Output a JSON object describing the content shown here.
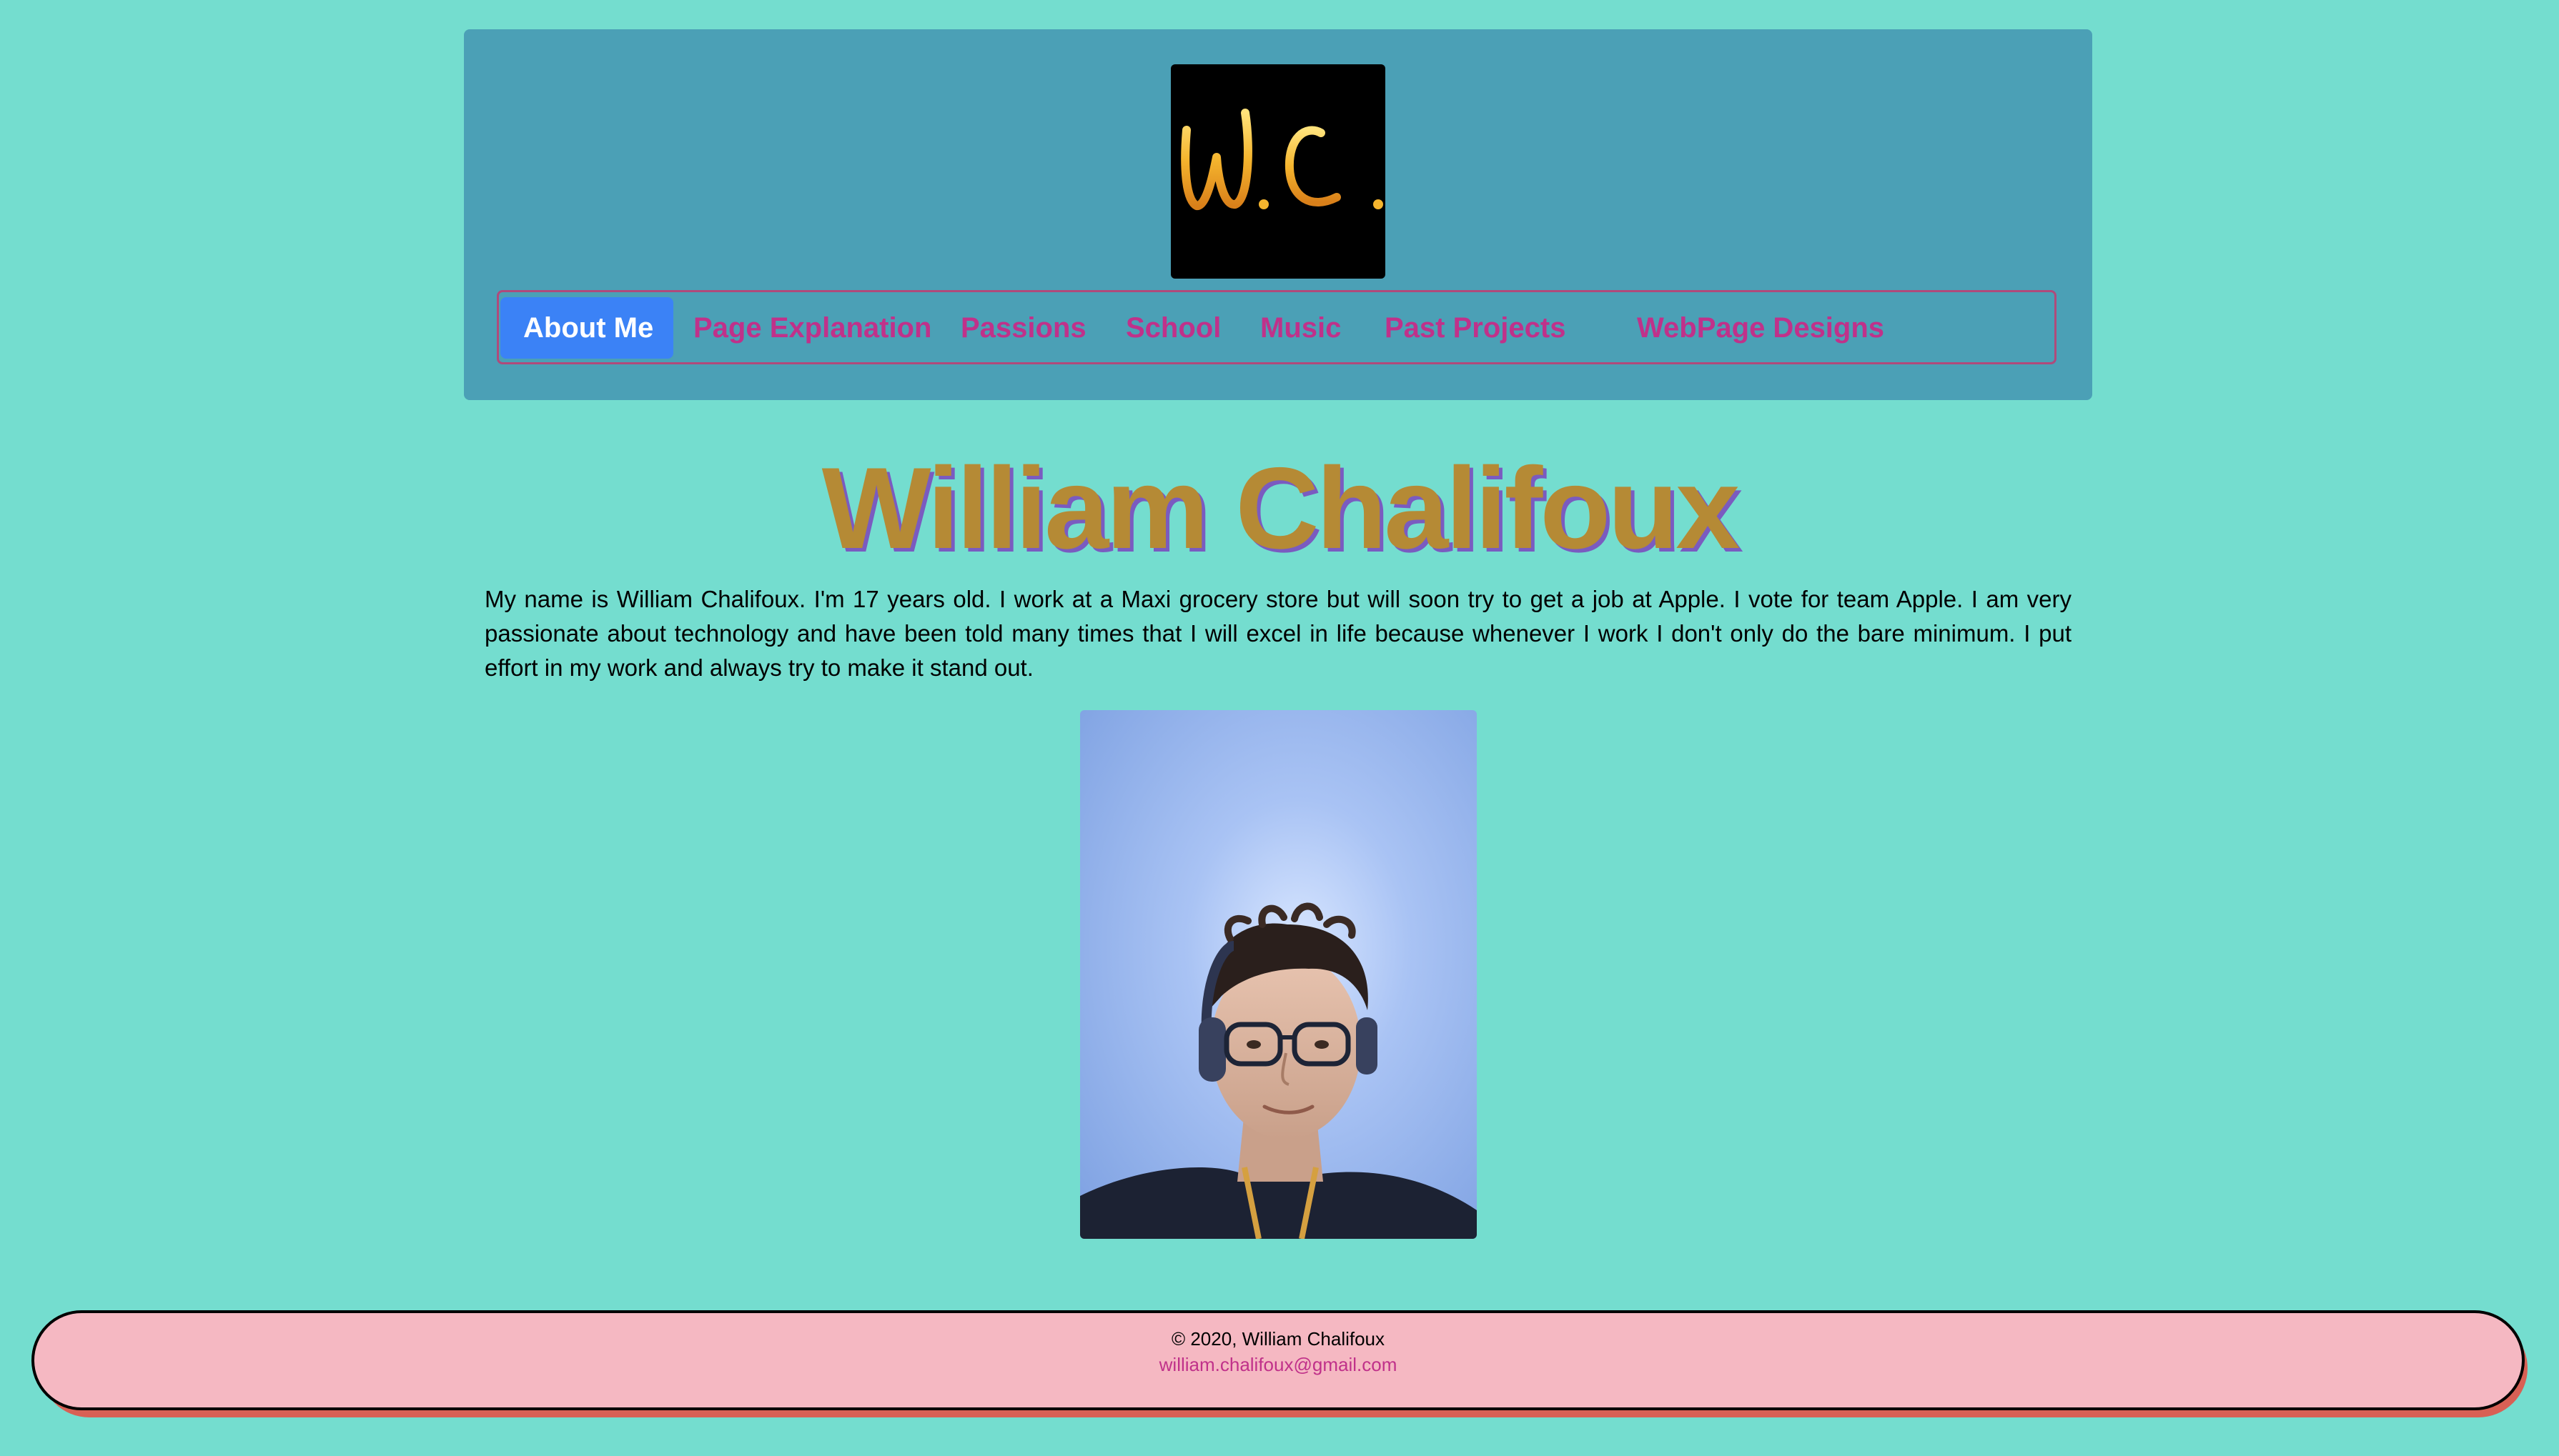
{
  "nav": {
    "items": [
      {
        "label": "About Me",
        "active": true
      },
      {
        "label": "Page Explanation",
        "active": false
      },
      {
        "label": "Passions",
        "active": false
      },
      {
        "label": "School",
        "active": false
      },
      {
        "label": "Music",
        "active": false
      },
      {
        "label": "Past Projects",
        "active": false
      },
      {
        "label": "WebPage Designs",
        "active": false
      }
    ]
  },
  "logo": {
    "text": "W.C.",
    "icon": "wc-signature-logo"
  },
  "main": {
    "title": "William Chalifoux",
    "bio": "My name is William Chalifoux. I'm 17 years old. I work at a Maxi grocery store but will soon try to get a job at Apple. I vote for team Apple. I am very passionate about technology and have been told many times that I will excel in life because whenever I work I don't only do the bare minimum. I put effort in my work and always try to make it stand out."
  },
  "footer": {
    "copyright": "© 2020, William Chalifoux",
    "email": "william.chalifoux@gmail.com"
  },
  "colors": {
    "page_bg": "#74ddcf",
    "header_bg": "#4ba0b6",
    "nav_link": "#c0318a",
    "nav_active_bg": "#3b82f6",
    "title": "#b58a35",
    "footer_bg": "#f5b8c2"
  }
}
